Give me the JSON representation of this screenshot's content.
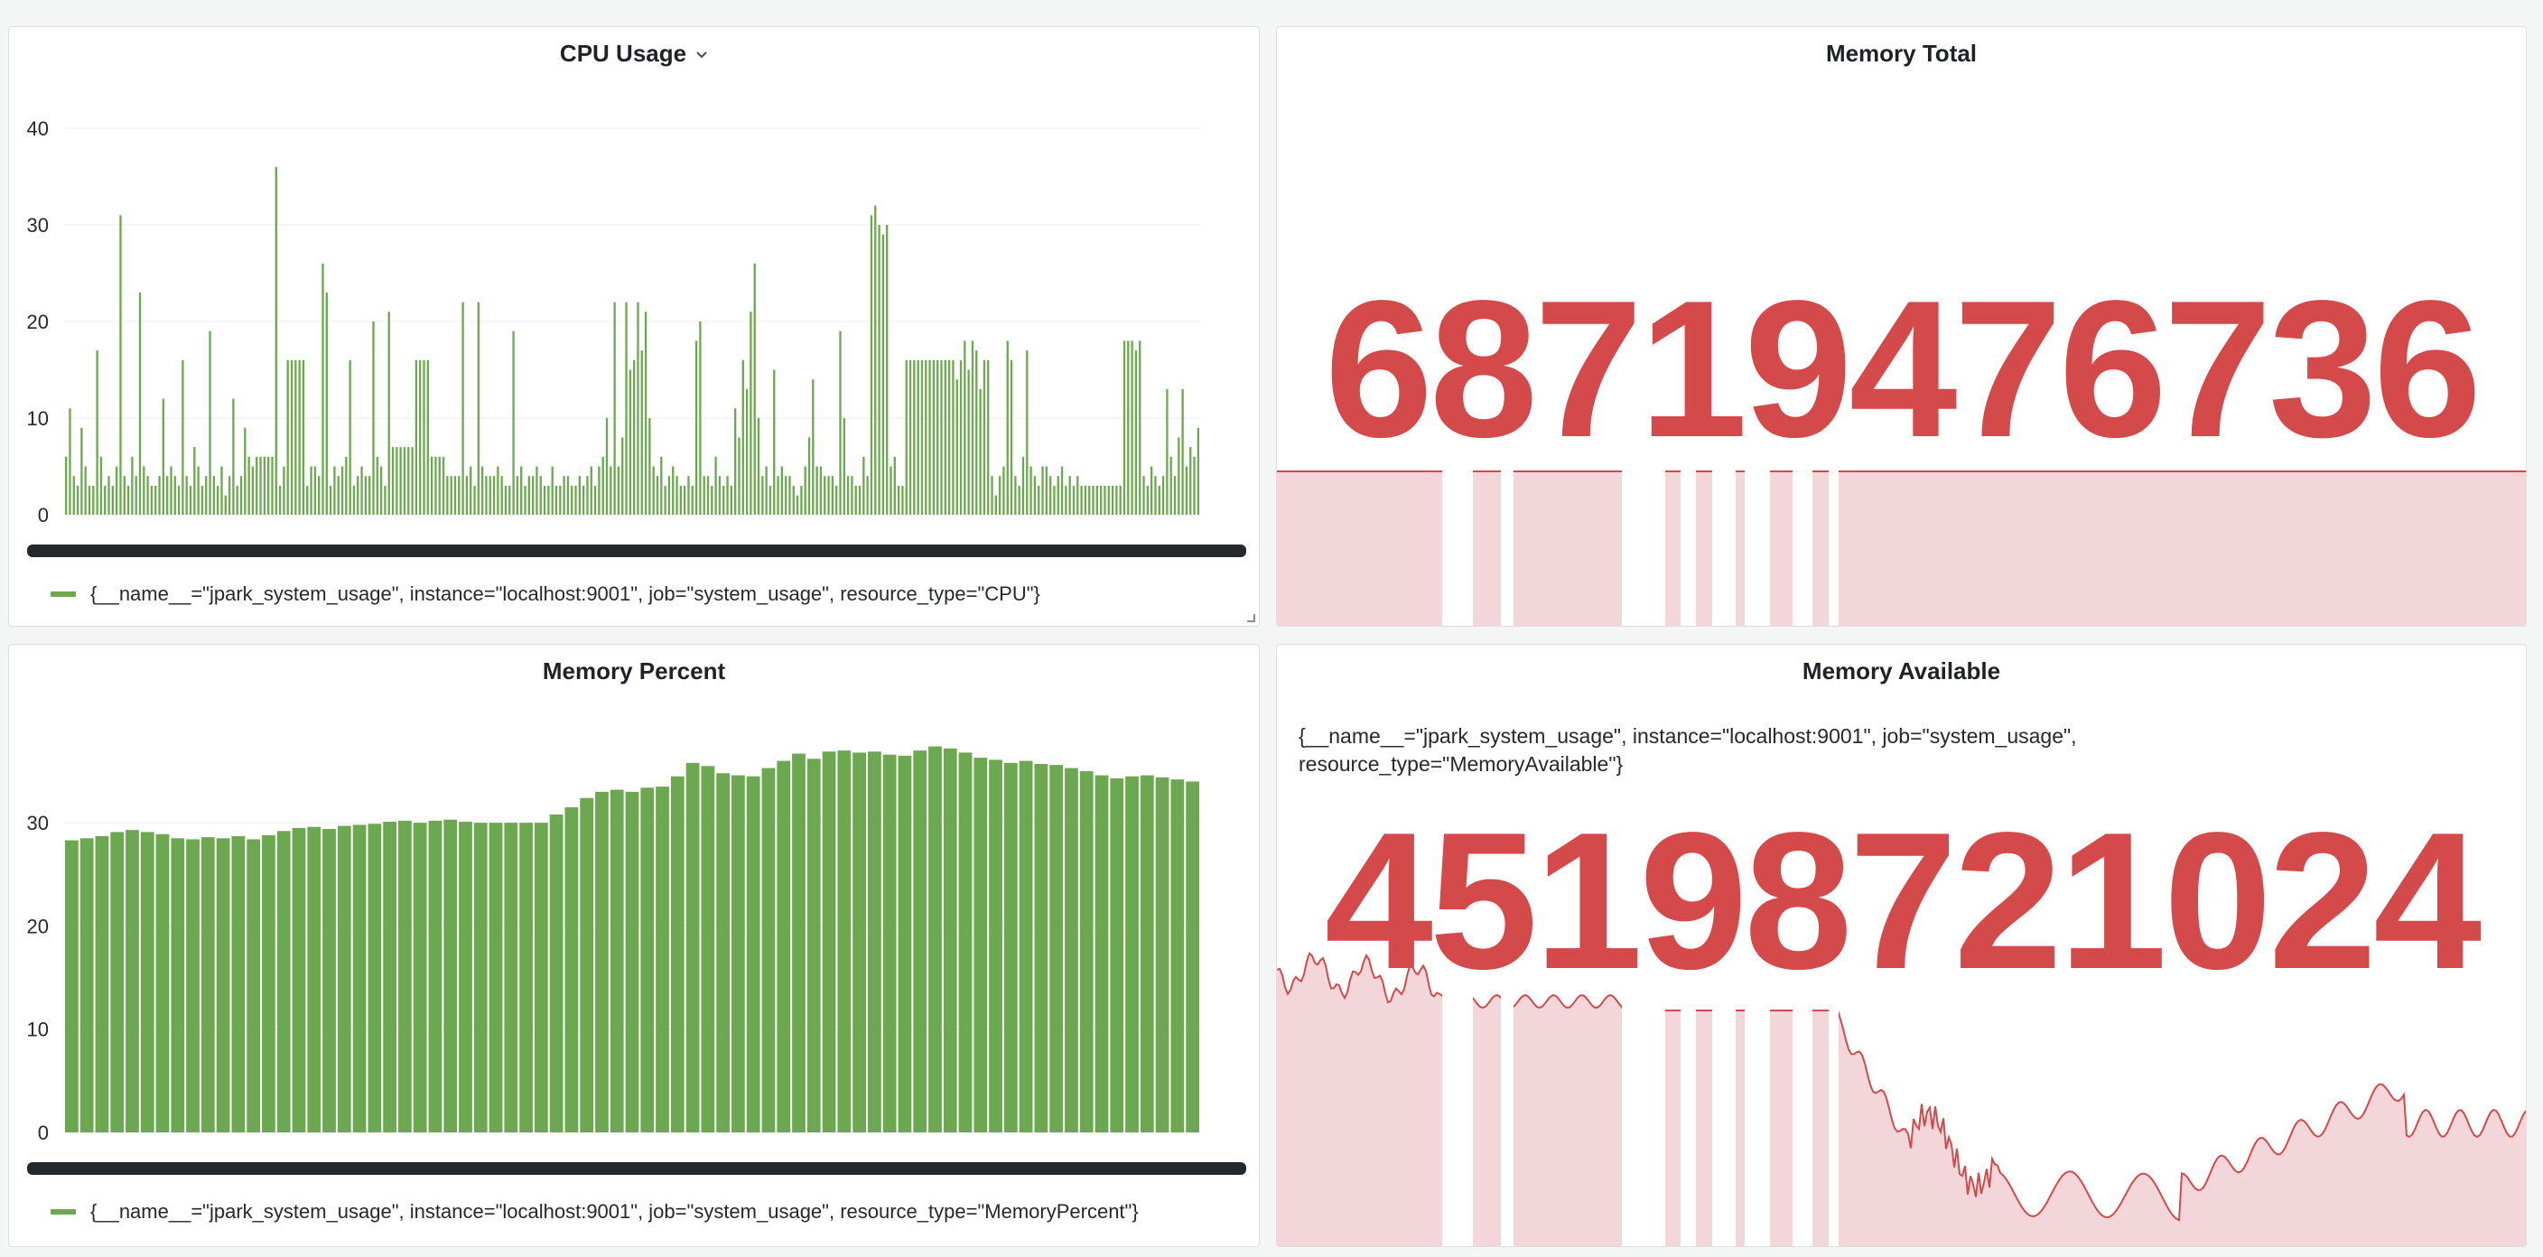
{
  "colors": {
    "series_green": "#6ca84f",
    "stat_red": "#d44a4a",
    "stat_fill": "#f3d6da",
    "page_bg": "#f4f5f5"
  },
  "panels": {
    "cpu": {
      "title": "CPU Usage",
      "legend": "{__name__=\"jpark_system_usage\", instance=\"localhost:9001\", job=\"system_usage\", resource_type=\"CPU\"}",
      "yticks": [
        "0",
        "10",
        "20",
        "30",
        "40"
      ]
    },
    "memory_total": {
      "title": "Memory Total",
      "value": "68719476736",
      "sparkline_level": 0.8
    },
    "memory_percent": {
      "title": "Memory Percent",
      "legend": "{__name__=\"jpark_system_usage\", instance=\"localhost:9001\", job=\"system_usage\", resource_type=\"MemoryPercent\"}",
      "yticks": [
        "0",
        "10",
        "20",
        "30"
      ]
    },
    "memory_available": {
      "title": "Memory Available",
      "series_label": "{__name__=\"jpark_system_usage\", instance=\"localhost:9001\", job=\"system_usage\", resource_type=\"MemoryAvailable\"}",
      "value": "45198721024"
    }
  },
  "chart_data": [
    {
      "type": "bar",
      "title": "CPU Usage",
      "ylim": [
        0,
        40
      ],
      "yticks": [
        0,
        10,
        20,
        30,
        40
      ],
      "series": [
        {
          "name": "{__name__=\"jpark_system_usage\", instance=\"localhost:9001\", job=\"system_usage\", resource_type=\"CPU\"}",
          "values": [
            6,
            11,
            4,
            3,
            9,
            5,
            3,
            3,
            17,
            6,
            3,
            4,
            3,
            5,
            31,
            4,
            3,
            6,
            4,
            23,
            5,
            4,
            3,
            3,
            4,
            12,
            4,
            5,
            4,
            3,
            16,
            4,
            3,
            7,
            5,
            3,
            4,
            19,
            4,
            3,
            5,
            2,
            4,
            12,
            3,
            4,
            9,
            6,
            5,
            6,
            6,
            6,
            6,
            6,
            36,
            3,
            5,
            16,
            16,
            16,
            16,
            16,
            3,
            5,
            5,
            4,
            26,
            23,
            3,
            5,
            4,
            5,
            6,
            16,
            3,
            4,
            5,
            4,
            4,
            20,
            6,
            5,
            3,
            21,
            7,
            7,
            7,
            7,
            7,
            7,
            16,
            16,
            16,
            16,
            6,
            6,
            6,
            6,
            4,
            4,
            4,
            4,
            22,
            4,
            5,
            3,
            22,
            5,
            4,
            4,
            4,
            5,
            4,
            3,
            3,
            19,
            4,
            5,
            3,
            4,
            4,
            5,
            4,
            3,
            3,
            5,
            3,
            3,
            4,
            4,
            3,
            3,
            4,
            3,
            4,
            5,
            3,
            5,
            6,
            10,
            5,
            22,
            5,
            8,
            22,
            15,
            16,
            22,
            17,
            21,
            10,
            5,
            4,
            6,
            3,
            4,
            5,
            4,
            3,
            3,
            4,
            3,
            18,
            20,
            4,
            4,
            3,
            6,
            4,
            3,
            4,
            3,
            11,
            8,
            16,
            13,
            21,
            26,
            10,
            4,
            5,
            3,
            15,
            4,
            5,
            4,
            4,
            3,
            2,
            3,
            5,
            8,
            14,
            5,
            5,
            4,
            4,
            4,
            3,
            19,
            10,
            4,
            4,
            3,
            3,
            6,
            4,
            31,
            32,
            30,
            29,
            30,
            5,
            6,
            3,
            3,
            16,
            16,
            16,
            16,
            16,
            16,
            16,
            16,
            16,
            16,
            16,
            16,
            16,
            14,
            16,
            18,
            15,
            18,
            17,
            13,
            16,
            16,
            4,
            2,
            4,
            5,
            18,
            16,
            4,
            3,
            6,
            17,
            5,
            4,
            3,
            5,
            5,
            4,
            3,
            4,
            5,
            3,
            4,
            3,
            4,
            3,
            3,
            3,
            3,
            3,
            3,
            3,
            3,
            3,
            3,
            3,
            18,
            18,
            18,
            17,
            18,
            4,
            3,
            5,
            4,
            3,
            4,
            13,
            6,
            4,
            8,
            13,
            5,
            7,
            6,
            9
          ]
        }
      ]
    },
    {
      "type": "bar",
      "title": "Memory Percent",
      "ylim": [
        0,
        35
      ],
      "yticks": [
        0,
        10,
        20,
        30
      ],
      "series": [
        {
          "name": "{__name__=\"jpark_system_usage\", instance=\"localhost:9001\", job=\"system_usage\", resource_type=\"MemoryPercent\"}",
          "values": [
            28.3,
            28.5,
            28.7,
            29.1,
            29.3,
            29.1,
            28.9,
            28.5,
            28.4,
            28.6,
            28.5,
            28.7,
            28.4,
            28.8,
            29.2,
            29.5,
            29.6,
            29.4,
            29.7,
            29.8,
            29.9,
            30.1,
            30.2,
            30.0,
            30.2,
            30.3,
            30.1,
            30.0,
            30.0,
            30.0,
            30.0,
            30.0,
            30.8,
            31.5,
            32.4,
            33.0,
            33.2,
            33.0,
            33.4,
            33.5,
            34.5,
            35.8,
            35.5,
            34.8,
            34.6,
            34.5,
            35.3,
            36.0,
            36.7,
            36.2,
            36.9,
            37.0,
            36.8,
            36.9,
            36.6,
            36.5,
            37.0,
            37.4,
            37.2,
            36.8,
            36.3,
            36.1,
            35.8,
            36.0,
            35.7,
            35.6,
            35.3,
            35.0,
            34.6,
            34.3,
            34.5,
            34.6,
            34.4,
            34.2,
            34.0
          ]
        }
      ]
    },
    {
      "type": "area",
      "title": "Memory Available",
      "value": "45198721024"
    }
  ]
}
